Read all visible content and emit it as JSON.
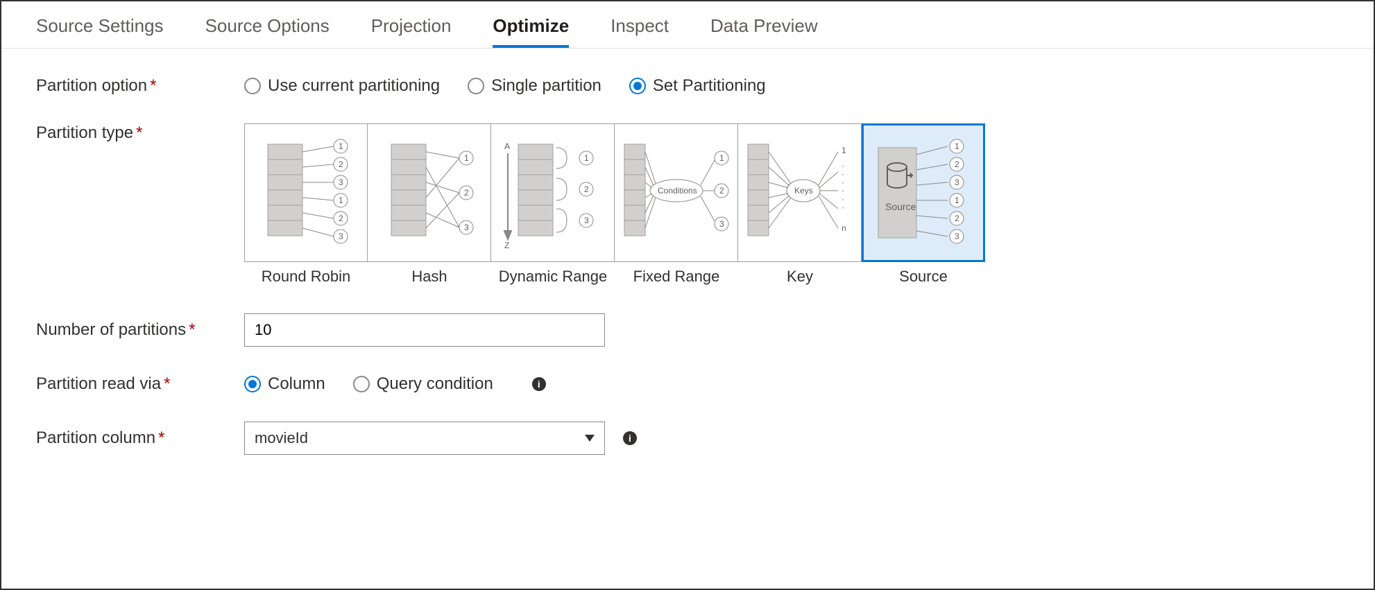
{
  "tabs": [
    {
      "label": "Source Settings",
      "active": false
    },
    {
      "label": "Source Options",
      "active": false
    },
    {
      "label": "Projection",
      "active": false
    },
    {
      "label": "Optimize",
      "active": true
    },
    {
      "label": "Inspect",
      "active": false
    },
    {
      "label": "Data Preview",
      "active": false
    }
  ],
  "fields": {
    "partition_option": {
      "label": "Partition option",
      "options": [
        "Use current partitioning",
        "Single partition",
        "Set Partitioning"
      ],
      "selected": "Set Partitioning"
    },
    "partition_type": {
      "label": "Partition type",
      "options": [
        "Round Robin",
        "Hash",
        "Dynamic Range",
        "Fixed Range",
        "Key",
        "Source"
      ],
      "selected": "Source"
    },
    "num_partitions": {
      "label": "Number of partitions",
      "value": "10"
    },
    "partition_read_via": {
      "label": "Partition read via",
      "options": [
        "Column",
        "Query condition"
      ],
      "selected": "Column"
    },
    "partition_column": {
      "label": "Partition column",
      "value": "movieId"
    }
  },
  "diagrams": {
    "fixed_range_label": "Conditions",
    "key_label": "Keys",
    "source_label": "Source"
  }
}
